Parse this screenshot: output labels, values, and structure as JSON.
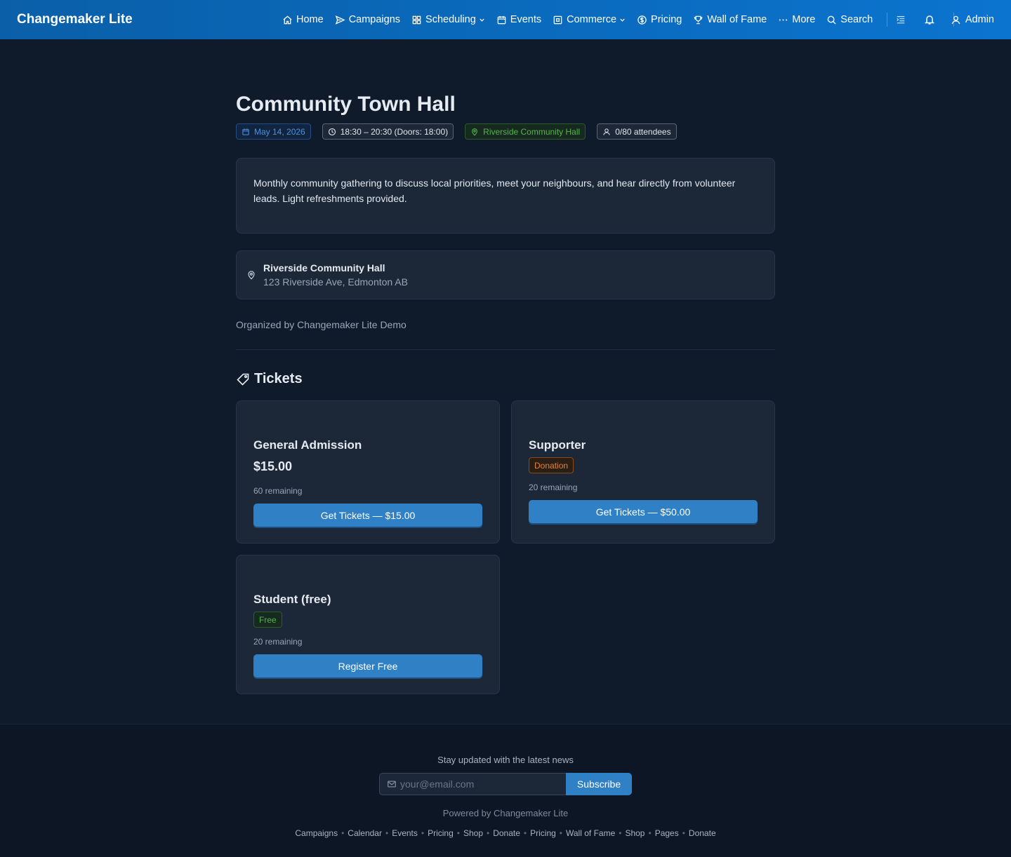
{
  "header": {
    "brand": "Changemaker Lite",
    "nav": [
      {
        "label": "Home",
        "icon": "home-icon"
      },
      {
        "label": "Campaigns",
        "icon": "send-icon"
      },
      {
        "label": "Scheduling",
        "icon": "grid-icon",
        "dropdown": true
      },
      {
        "label": "Events",
        "icon": "calendar-icon"
      },
      {
        "label": "Commerce",
        "icon": "store-icon",
        "dropdown": true
      },
      {
        "label": "Pricing",
        "icon": "dollar-icon"
      },
      {
        "label": "Wall of Fame",
        "icon": "trophy-icon"
      },
      {
        "label": "More",
        "icon": "ellipsis-icon"
      },
      {
        "label": "Search",
        "icon": "search-icon"
      }
    ],
    "admin_label": "Admin"
  },
  "event": {
    "title": "Community Town Hall",
    "date": "May 14, 2026",
    "time": "18:30 – 20:30 (Doors: 18:00)",
    "location_chip": "Riverside Community Hall",
    "attendees": "0/80 attendees",
    "description": "Monthly community gathering to discuss local priorities, meet your neighbours, and hear directly from volunteer leads. Light refreshments provided.",
    "venue_name": "Riverside Community Hall",
    "venue_address": "123 Riverside Ave, Edmonton AB",
    "organizer": "Organized by Changemaker Lite Demo"
  },
  "tickets": {
    "heading": "Tickets",
    "items": [
      {
        "name": "General Admission",
        "price": "$15.00",
        "remaining": "60 remaining",
        "button": "Get Tickets — $15.00"
      },
      {
        "name": "Supporter",
        "tag": "Donation",
        "remaining": "20 remaining",
        "button": "Get Tickets — $50.00"
      },
      {
        "name": "Student (free)",
        "tag": "Free",
        "remaining": "20 remaining",
        "button": "Register Free"
      }
    ]
  },
  "footer": {
    "newsletter_text": "Stay updated with the latest news",
    "email_placeholder": "your@email.com",
    "subscribe_label": "Subscribe",
    "powered_by": "Powered by Changemaker Lite",
    "links": [
      "Campaigns",
      "Calendar",
      "Events",
      "Pricing",
      "Shop",
      "Donate",
      "Pricing",
      "Wall of Fame",
      "Shop",
      "Pages",
      "Donate"
    ]
  },
  "colors": {
    "header_start": "#0a5fa8",
    "header_end": "#0b74cf",
    "background": "#0f1a2b",
    "card": "#1c2738",
    "button": "#2f80c4",
    "donation_tag": "#e0843a",
    "free_tag": "#56b54c"
  }
}
